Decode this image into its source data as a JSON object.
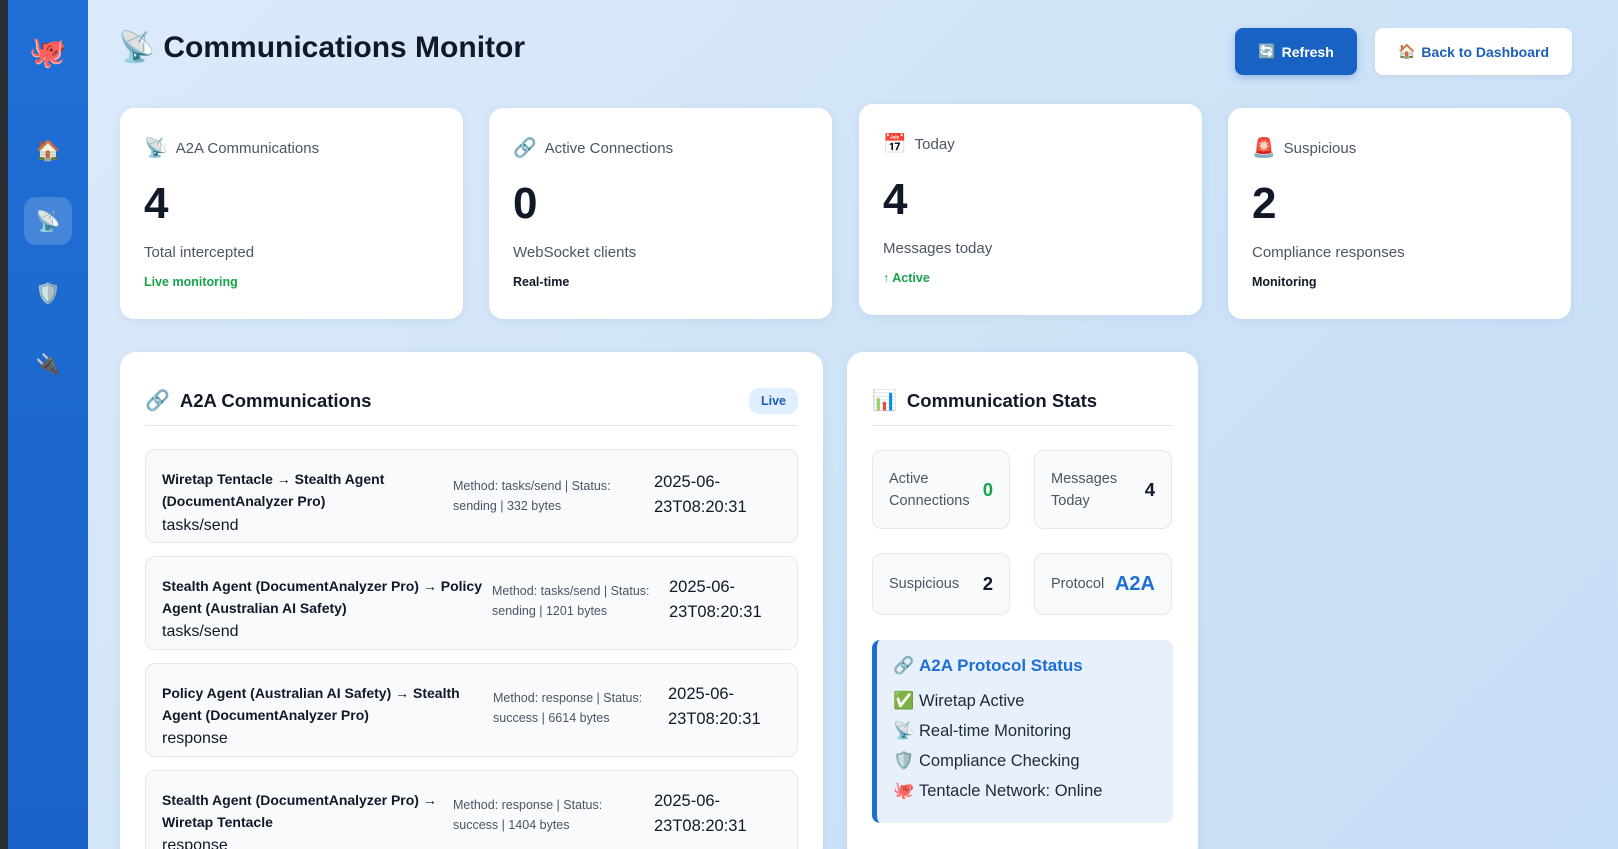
{
  "sidebar": {
    "logo_icon": "🐙",
    "items": [
      {
        "name": "home",
        "icon": "🏠"
      },
      {
        "name": "communications",
        "icon": "📡"
      },
      {
        "name": "security",
        "icon": "🛡️"
      },
      {
        "name": "plugins",
        "icon": "🔌"
      }
    ]
  },
  "header": {
    "icon": "📡",
    "title": "Communications Monitor",
    "refresh_icon": "🔄",
    "refresh_label": "Refresh",
    "back_icon": "🏠",
    "back_label": "Back to Dashboard"
  },
  "stats": [
    {
      "icon": "📡",
      "label": "A2A Communications",
      "value": "4",
      "sub": "Total intercepted",
      "foot": "Live monitoring"
    },
    {
      "icon": "🔗",
      "label": "Active Connections",
      "value": "0",
      "sub": "WebSocket clients",
      "foot": "Real-time"
    },
    {
      "icon": "📅",
      "label": "Today",
      "value": "4",
      "sub": "Messages today",
      "foot": "↑ Active"
    },
    {
      "icon": "🚨",
      "label": "Suspicious",
      "value": "2",
      "sub": "Compliance responses",
      "foot": "Monitoring"
    }
  ],
  "comms_panel": {
    "icon": "🔗",
    "title": "A2A Communications",
    "badge": "Live",
    "messages": [
      {
        "route_line1": "Wiretap Tentacle → Stealth Agent",
        "route_line2": "(DocumentAnalyzer Pro)",
        "method": "tasks/send",
        "meta_line1": "Method: tasks/send | Status:",
        "meta_line2": "sending | 332 bytes",
        "time_line1": "2025-06-",
        "time_line2": "23T08:20:31"
      },
      {
        "route_line1": "Stealth Agent (DocumentAnalyzer Pro) → Policy",
        "route_line2": "Agent (Australian AI Safety)",
        "method": "tasks/send",
        "meta_line1": "Method: tasks/send | Status:",
        "meta_line2": "sending | 1201 bytes",
        "time_line1": "2025-06-",
        "time_line2": "23T08:20:31"
      },
      {
        "route_line1": "Policy Agent (Australian AI Safety) → Stealth",
        "route_line2": "Agent (DocumentAnalyzer Pro)",
        "method": "response",
        "meta_line1": "Method: response | Status:",
        "meta_line2": "success | 6614 bytes",
        "time_line1": "2025-06-",
        "time_line2": "23T08:20:31"
      },
      {
        "route_line1": "Stealth Agent (DocumentAnalyzer Pro) →",
        "route_line2": "Wiretap Tentacle",
        "method": "response",
        "meta_line1": "Method: response | Status:",
        "meta_line2": "success | 1404 bytes",
        "time_line1": "2025-06-",
        "time_line2": "23T08:20:31"
      }
    ]
  },
  "stats_panel": {
    "icon": "📊",
    "title": "Communication Stats",
    "minis": [
      {
        "label_line1": "Active",
        "label_line2": "Connections",
        "value": "0"
      },
      {
        "label_line1": "Messages",
        "label_line2": "Today",
        "value": "4"
      },
      {
        "label_line1": "Suspicious",
        "label_line2": "",
        "value": "2"
      },
      {
        "label_line1": "Protocol",
        "label_line2": "",
        "value": "A2A"
      }
    ],
    "protocol_status": {
      "icon": "🔗",
      "title": "A2A Protocol Status",
      "items": [
        {
          "icon": "✅",
          "text": "Wiretap Active"
        },
        {
          "icon": "📡",
          "text": "Real-time Monitoring"
        },
        {
          "icon": "🛡️",
          "text": "Compliance Checking"
        },
        {
          "icon": "🐙",
          "text": "Tentacle Network: Online"
        }
      ]
    }
  }
}
